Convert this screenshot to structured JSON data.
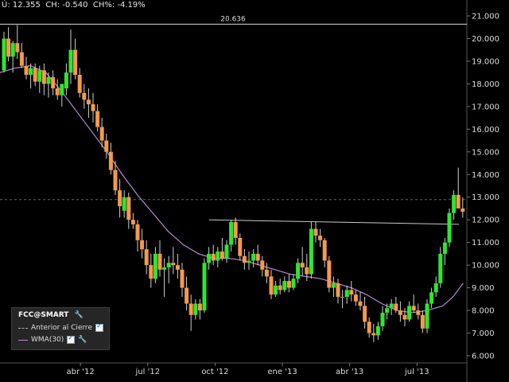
{
  "status": {
    "text": "Ú: 12.355  CH: -0.540  CH%: -4.19%"
  },
  "colors": {
    "background": "#000000",
    "up": "#2ee62e",
    "down": "#f5994a",
    "wma": "#b78ad6",
    "hline": "#dddddd",
    "trend": "#c8c8c8",
    "grid": "#555555",
    "text": "#dddddd"
  },
  "legend": {
    "title": "FCC@SMART",
    "title_icon": "wrench-icon",
    "items": [
      {
        "label": "Anterior al Cierre",
        "style": "dashed",
        "checked": true
      },
      {
        "label": "WMA(30)",
        "style": "solid",
        "checked": true,
        "icon": "wrench-icon"
      }
    ]
  },
  "chart_data": {
    "type": "candlestick",
    "ylim": [
      6.0,
      21.0
    ],
    "y_ticks": [
      "6.000",
      "7.000",
      "8.000",
      "9.000",
      "10.000",
      "11.000",
      "12.000",
      "13.000",
      "14.000",
      "15.000",
      "16.000",
      "17.000",
      "18.000",
      "19.000",
      "20.000",
      "21.000"
    ],
    "x_range": [
      0,
      150
    ],
    "x_ticks": [
      {
        "label": "abr '12",
        "t": 25
      },
      {
        "label": "jul '12",
        "t": 47
      },
      {
        "label": "oct '12",
        "t": 69
      },
      {
        "label": "ene '13",
        "t": 91
      },
      {
        "label": "abr '13",
        "t": 113
      },
      {
        "label": "jul '13",
        "t": 135
      }
    ],
    "high_line": {
      "value": 20.636,
      "label": "20.636"
    },
    "trendline": {
      "t1": 67,
      "v1": 12.0,
      "t2": 150,
      "v2": 11.8
    },
    "candles": [
      [
        0,
        18.6,
        20.3,
        18.5,
        20.0
      ],
      [
        1,
        20.0,
        20.5,
        19.0,
        19.2
      ],
      [
        2,
        19.2,
        19.9,
        18.5,
        19.8
      ],
      [
        3,
        19.8,
        20.6,
        19.1,
        19.4
      ],
      [
        4,
        19.4,
        19.8,
        18.7,
        18.8
      ],
      [
        5,
        18.8,
        19.2,
        18.2,
        18.4
      ],
      [
        6,
        18.4,
        18.9,
        17.8,
        18.7
      ],
      [
        7,
        18.7,
        18.9,
        17.9,
        18.1
      ],
      [
        8,
        18.1,
        18.8,
        17.6,
        18.6
      ],
      [
        9,
        18.6,
        18.9,
        17.5,
        18.0
      ],
      [
        10,
        18.0,
        18.5,
        17.4,
        18.3
      ],
      [
        11,
        18.3,
        18.6,
        17.5,
        17.8
      ],
      [
        12,
        17.8,
        18.2,
        17.3,
        17.5
      ],
      [
        13,
        17.5,
        18.0,
        17.0,
        18.0
      ],
      [
        14,
        17.8,
        18.9,
        17.5,
        18.5
      ],
      [
        15,
        18.5,
        20.4,
        18.0,
        19.5
      ],
      [
        16,
        19.5,
        20.0,
        18.2,
        18.4
      ],
      [
        17,
        18.4,
        18.7,
        17.4,
        17.6
      ],
      [
        18,
        17.6,
        18.0,
        16.9,
        17.3
      ],
      [
        19,
        17.3,
        17.8,
        16.5,
        17.1
      ],
      [
        20,
        17.1,
        17.6,
        16.3,
        16.8
      ],
      [
        21,
        16.8,
        17.1,
        15.9,
        16.1
      ],
      [
        22,
        16.1,
        16.5,
        15.2,
        15.5
      ],
      [
        23,
        15.5,
        15.8,
        14.7,
        15.0
      ],
      [
        24,
        15.0,
        15.4,
        14.0,
        14.2
      ],
      [
        25,
        14.2,
        14.6,
        13.1,
        13.3
      ],
      [
        26,
        13.3,
        13.8,
        12.1,
        12.6
      ],
      [
        27,
        12.4,
        13.3,
        12.1,
        13.0
      ],
      [
        28,
        13.0,
        13.2,
        11.6,
        12.0
      ],
      [
        29,
        12.0,
        12.3,
        11.6,
        11.8
      ],
      [
        30,
        11.8,
        12.0,
        10.6,
        11.1
      ],
      [
        31,
        11.1,
        11.6,
        10.3,
        10.7
      ],
      [
        32,
        10.7,
        11.1,
        9.6,
        10.0
      ],
      [
        33,
        10.0,
        10.5,
        9.0,
        9.4
      ],
      [
        34,
        9.4,
        10.8,
        9.2,
        10.5
      ],
      [
        35,
        10.5,
        11.1,
        9.5,
        9.8
      ],
      [
        36,
        9.8,
        10.3,
        8.6,
        9.9
      ],
      [
        37,
        9.9,
        10.4,
        9.2,
        10.1
      ],
      [
        38,
        10.1,
        10.8,
        9.6,
        10.0
      ],
      [
        39,
        10.0,
        10.5,
        9.4,
        9.8
      ],
      [
        40,
        9.8,
        10.1,
        8.6,
        9.0
      ],
      [
        41,
        9.0,
        9.5,
        8.0,
        8.3
      ],
      [
        42,
        8.3,
        8.7,
        7.1,
        7.8
      ],
      [
        43,
        7.8,
        8.5,
        7.6,
        8.3
      ],
      [
        44,
        8.3,
        8.5,
        7.6,
        8.0
      ],
      [
        45,
        8.0,
        10.3,
        7.9,
        10.1
      ],
      [
        46,
        10.1,
        10.8,
        9.8,
        10.5
      ],
      [
        47,
        10.5,
        10.9,
        10.0,
        10.2
      ],
      [
        48,
        10.2,
        10.8,
        9.9,
        10.6
      ],
      [
        49,
        10.6,
        11.2,
        10.2,
        10.3
      ],
      [
        50,
        10.3,
        11.1,
        10.1,
        10.9
      ],
      [
        51,
        10.9,
        12.0,
        10.6,
        11.9
      ],
      [
        52,
        11.9,
        12.1,
        10.9,
        11.2
      ],
      [
        53,
        11.2,
        11.4,
        10.2,
        10.4
      ],
      [
        54,
        10.4,
        10.7,
        9.8,
        10.1
      ],
      [
        55,
        10.1,
        10.6,
        9.8,
        10.2
      ],
      [
        56,
        10.2,
        10.7,
        9.9,
        10.5
      ],
      [
        57,
        10.5,
        10.9,
        10.0,
        10.2
      ],
      [
        58,
        10.2,
        10.4,
        9.5,
        9.8
      ],
      [
        59,
        9.8,
        10.1,
        9.2,
        9.5
      ],
      [
        60,
        9.5,
        9.8,
        8.5,
        8.7
      ],
      [
        61,
        8.7,
        9.3,
        8.6,
        9.1
      ],
      [
        62,
        9.1,
        9.4,
        8.7,
        8.9
      ],
      [
        63,
        8.9,
        9.5,
        8.8,
        9.3
      ],
      [
        64,
        9.3,
        9.6,
        8.8,
        9.0
      ],
      [
        65,
        9.0,
        9.6,
        8.9,
        9.4
      ],
      [
        66,
        9.4,
        10.3,
        9.2,
        10.1
      ],
      [
        67,
        10.1,
        10.8,
        9.5,
        9.9
      ],
      [
        68,
        9.9,
        10.5,
        9.3,
        9.6
      ],
      [
        69,
        9.6,
        11.9,
        9.4,
        11.6
      ],
      [
        70,
        11.6,
        11.9,
        11.0,
        11.3
      ],
      [
        71,
        11.3,
        11.6,
        10.8,
        11.1
      ],
      [
        72,
        11.1,
        11.2,
        9.9,
        10.2
      ],
      [
        73,
        10.2,
        10.4,
        8.8,
        9.0
      ],
      [
        74,
        9.0,
        9.5,
        8.6,
        9.2
      ],
      [
        75,
        9.2,
        9.4,
        8.3,
        8.6
      ],
      [
        76,
        8.6,
        8.9,
        8.1,
        8.6
      ],
      [
        77,
        8.6,
        9.1,
        8.3,
        8.9
      ],
      [
        78,
        8.9,
        9.3,
        8.4,
        8.7
      ],
      [
        79,
        8.7,
        8.9,
        8.2,
        8.4
      ],
      [
        80,
        8.4,
        8.8,
        8.0,
        8.2
      ],
      [
        81,
        8.2,
        8.6,
        7.2,
        7.5
      ],
      [
        82,
        7.5,
        7.7,
        6.8,
        7.0
      ],
      [
        83,
        7.0,
        7.4,
        6.6,
        6.9
      ],
      [
        84,
        6.9,
        7.5,
        6.7,
        7.3
      ],
      [
        85,
        7.3,
        8.2,
        7.1,
        7.9
      ],
      [
        86,
        7.9,
        8.3,
        7.6,
        8.1
      ],
      [
        87,
        8.1,
        8.5,
        7.8,
        8.3
      ],
      [
        88,
        8.3,
        8.6,
        7.9,
        8.0
      ],
      [
        89,
        8.0,
        8.4,
        7.5,
        7.8
      ],
      [
        90,
        7.8,
        8.1,
        7.3,
        7.6
      ],
      [
        91,
        7.6,
        8.4,
        7.5,
        8.2
      ],
      [
        92,
        8.2,
        8.7,
        7.9,
        8.0
      ],
      [
        93,
        8.0,
        8.3,
        7.6,
        7.8
      ],
      [
        94,
        7.8,
        8.0,
        7.0,
        7.2
      ],
      [
        95,
        7.2,
        8.5,
        7.0,
        8.3
      ],
      [
        96,
        8.3,
        9.0,
        8.1,
        8.8
      ],
      [
        97,
        8.8,
        9.5,
        8.6,
        9.2
      ],
      [
        98,
        9.2,
        10.8,
        9.0,
        10.5
      ],
      [
        99,
        10.5,
        11.2,
        10.0,
        11.0
      ],
      [
        100,
        11.0,
        12.5,
        10.8,
        12.3
      ],
      [
        101,
        12.3,
        13.3,
        12.0,
        13.1
      ],
      [
        102,
        13.1,
        14.3,
        12.9,
        12.5
      ],
      [
        103,
        12.5,
        13.0,
        12.1,
        12.355
      ]
    ],
    "wma": [
      [
        0,
        18.5
      ],
      [
        6,
        18.7
      ],
      [
        12,
        18.8
      ],
      [
        18,
        18.5
      ],
      [
        24,
        17.7
      ],
      [
        30,
        16.8
      ],
      [
        36,
        15.9
      ],
      [
        42,
        15.0
      ],
      [
        48,
        14.0
      ],
      [
        54,
        13.1
      ],
      [
        60,
        12.3
      ],
      [
        66,
        11.5
      ],
      [
        72,
        10.9
      ],
      [
        78,
        10.5
      ],
      [
        84,
        10.3
      ],
      [
        90,
        10.3
      ],
      [
        96,
        10.2
      ],
      [
        102,
        10.0
      ],
      [
        108,
        9.8
      ],
      [
        114,
        9.6
      ],
      [
        120,
        9.5
      ],
      [
        126,
        9.4
      ],
      [
        132,
        9.2
      ],
      [
        138,
        9.0
      ],
      [
        144,
        8.7
      ],
      [
        150,
        8.3
      ],
      [
        156,
        8.0
      ],
      [
        162,
        7.9
      ],
      [
        168,
        8.0
      ],
      [
        174,
        8.2
      ],
      [
        178,
        8.6
      ],
      [
        182,
        9.2
      ]
    ]
  }
}
